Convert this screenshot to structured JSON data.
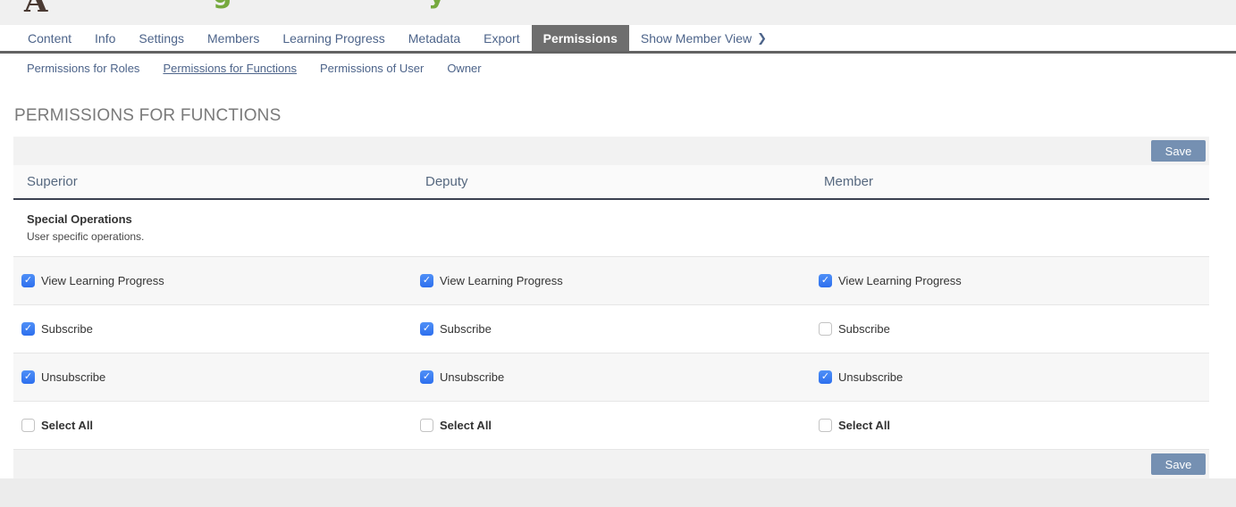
{
  "header": {
    "cropped_title_fragments": [
      {
        "glyph": "A",
        "color": "#4a3a33"
      },
      {
        "glyph": "g",
        "color": "#76a93e"
      },
      {
        "glyph": "y",
        "color": "#76a93e"
      }
    ]
  },
  "tabs": {
    "items": [
      "Content",
      "Info",
      "Settings",
      "Members",
      "Learning Progress",
      "Metadata",
      "Export",
      "Permissions"
    ],
    "active": "Permissions",
    "member_view": {
      "label": "Show Member View",
      "chevron": "❯"
    }
  },
  "subtabs": {
    "items": [
      "Permissions for Roles",
      "Permissions for Functions",
      "Permissions of User",
      "Owner"
    ],
    "active": "Permissions for Functions"
  },
  "page": {
    "title": "PERMISSIONS FOR FUNCTIONS"
  },
  "toolbar": {
    "save_label": "Save"
  },
  "table": {
    "columns": [
      "Superior",
      "Deputy",
      "Member"
    ],
    "section": {
      "title": "Special Operations",
      "description": "User specific operations."
    },
    "rows": [
      {
        "label": "View Learning Progress",
        "checked": [
          true,
          true,
          true
        ]
      },
      {
        "label": "Subscribe",
        "checked": [
          true,
          true,
          false
        ]
      },
      {
        "label": "Unsubscribe",
        "checked": [
          true,
          true,
          true
        ]
      },
      {
        "label": "Select All",
        "checked": [
          false,
          false,
          false
        ]
      }
    ]
  },
  "footer": {
    "save_label": "Save"
  },
  "colors": {
    "checkbox_blue": "#3b7df2",
    "save_button": "#7590b2",
    "active_tab_bg": "#6e6e6e",
    "tab_text": "#4d648a",
    "tabbar_border": "#636363",
    "heading_gray": "#7a7a7a",
    "header_row_border": "#3a4050",
    "fragment_green": "#76a93e",
    "fragment_brown": "#4a3a33"
  }
}
